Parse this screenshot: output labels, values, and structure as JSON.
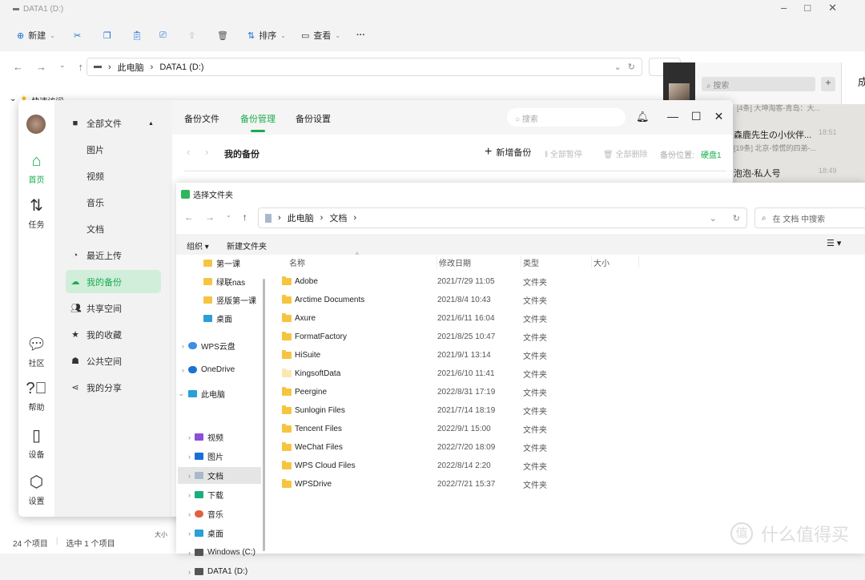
{
  "explorer": {
    "title": "DATA1 (D:)",
    "toolbar": {
      "new": "新建",
      "sort": "排序",
      "view": "查看",
      "more": "···"
    },
    "breadcrumb": [
      "此电脑",
      "DATA1 (D:)"
    ],
    "quick_access": "快速访问",
    "status": {
      "count": "24 个项目",
      "selected": "选中 1 个项目"
    },
    "status_extra": "大小"
  },
  "wechat": {
    "search_placeholder": "搜索",
    "add": "+",
    "header_partial": "成",
    "chats": [
      {
        "name": "",
        "preview": "[4条] 大坤淘客-青岛：大...",
        "time": ""
      },
      {
        "name": "森鹿先生の小伙伴...",
        "preview": "[19条] 北京-惊慌的四弟-...",
        "time": "18:51"
      },
      {
        "name": "泡泡-私人号",
        "preview": "",
        "time": "18:49"
      }
    ]
  },
  "backup": {
    "rail": [
      {
        "label": "首页",
        "icon": "home-icon",
        "active": true
      },
      {
        "label": "任务",
        "icon": "transfer-icon"
      },
      {
        "label": "社区",
        "icon": "chat-icon"
      },
      {
        "label": "帮助",
        "icon": "help-icon"
      },
      {
        "label": "设备",
        "icon": "device-icon"
      },
      {
        "label": "设置",
        "icon": "settings-icon"
      }
    ],
    "nav": [
      {
        "label": "全部文件",
        "icon": "folder-icon"
      },
      {
        "label": "图片",
        "sub": true
      },
      {
        "label": "视频",
        "sub": true
      },
      {
        "label": "音乐",
        "sub": true
      },
      {
        "label": "文档",
        "sub": true
      },
      {
        "label": "最近上传",
        "icon": "clock-icon"
      },
      {
        "label": "我的备份",
        "icon": "cloud-upload-icon",
        "active": true
      },
      {
        "label": "共享空间",
        "icon": "users-icon"
      },
      {
        "label": "我的收藏",
        "icon": "star-icon"
      },
      {
        "label": "公共空间",
        "icon": "group-icon"
      },
      {
        "label": "我的分享",
        "icon": "share-icon"
      }
    ],
    "tabs": [
      {
        "label": "备份文件"
      },
      {
        "label": "备份管理",
        "active": true
      },
      {
        "label": "备份设置"
      }
    ],
    "search_placeholder": "搜索",
    "page_title": "我的备份",
    "add_backup": "新增备份",
    "pause_all": "全部暂停",
    "delete_all": "全部删除",
    "location_label": "备份位置:",
    "location_value": "硬盘1",
    "accent": "#1aad4f"
  },
  "picker": {
    "title": "选择文件夹",
    "breadcrumb": [
      "此电脑",
      "文档"
    ],
    "search_placeholder": "在 文档 中搜索",
    "organize": "组织 ▾",
    "new_folder": "新建文件夹",
    "tree": [
      {
        "label": "第一课",
        "icon": "folder-icon"
      },
      {
        "label": "绿联nas",
        "icon": "folder-icon"
      },
      {
        "label": "竖版第一课",
        "icon": "folder-icon"
      },
      {
        "label": "桌面",
        "icon": "desktop-icon"
      },
      {
        "label": "WPS云盘",
        "icon": "cloud-icon",
        "expand": true
      },
      {
        "label": "OneDrive",
        "icon": "onedrive-icon",
        "expand": true
      },
      {
        "label": "此电脑",
        "icon": "pc-icon",
        "open": true
      },
      {
        "label": "视频",
        "icon": "video-icon",
        "expand": true,
        "child": true
      },
      {
        "label": "图片",
        "icon": "picture-icon",
        "expand": true,
        "child": true
      },
      {
        "label": "文档",
        "icon": "document-icon",
        "expand": true,
        "child": true,
        "selected": true
      },
      {
        "label": "下载",
        "icon": "download-icon",
        "expand": true,
        "child": true
      },
      {
        "label": "音乐",
        "icon": "music-icon",
        "expand": true,
        "child": true
      },
      {
        "label": "桌面",
        "icon": "desktop-icon",
        "expand": true,
        "child": true
      },
      {
        "label": "Windows (C:)",
        "icon": "drive-icon",
        "expand": true,
        "child": true
      },
      {
        "label": "DATA1 (D:)",
        "icon": "drive-icon",
        "expand": true,
        "child": true
      }
    ],
    "columns": [
      "名称",
      "修改日期",
      "类型",
      "大小"
    ],
    "files": [
      {
        "name": "Adobe",
        "date": "2021/7/29 11:05",
        "type": "文件夹"
      },
      {
        "name": "Arctime Documents",
        "date": "2021/8/4 10:43",
        "type": "文件夹"
      },
      {
        "name": "Axure",
        "date": "2021/6/11 16:04",
        "type": "文件夹"
      },
      {
        "name": "FormatFactory",
        "date": "2021/8/25 10:47",
        "type": "文件夹"
      },
      {
        "name": "HiSuite",
        "date": "2021/9/1 13:14",
        "type": "文件夹"
      },
      {
        "name": "KingsoftData",
        "date": "2021/6/10 11:41",
        "type": "文件夹"
      },
      {
        "name": "Peergine",
        "date": "2022/8/31 17:19",
        "type": "文件夹"
      },
      {
        "name": "Sunlogin Files",
        "date": "2021/7/14 18:19",
        "type": "文件夹"
      },
      {
        "name": "Tencent Files",
        "date": "2022/9/1 15:00",
        "type": "文件夹"
      },
      {
        "name": "WeChat Files",
        "date": "2022/7/20 18:09",
        "type": "文件夹"
      },
      {
        "name": "WPS Cloud Files",
        "date": "2022/8/14 2:20",
        "type": "文件夹"
      },
      {
        "name": "WPSDrive",
        "date": "2022/7/21 15:37",
        "type": "文件夹"
      }
    ]
  },
  "watermark": "什么值得买"
}
